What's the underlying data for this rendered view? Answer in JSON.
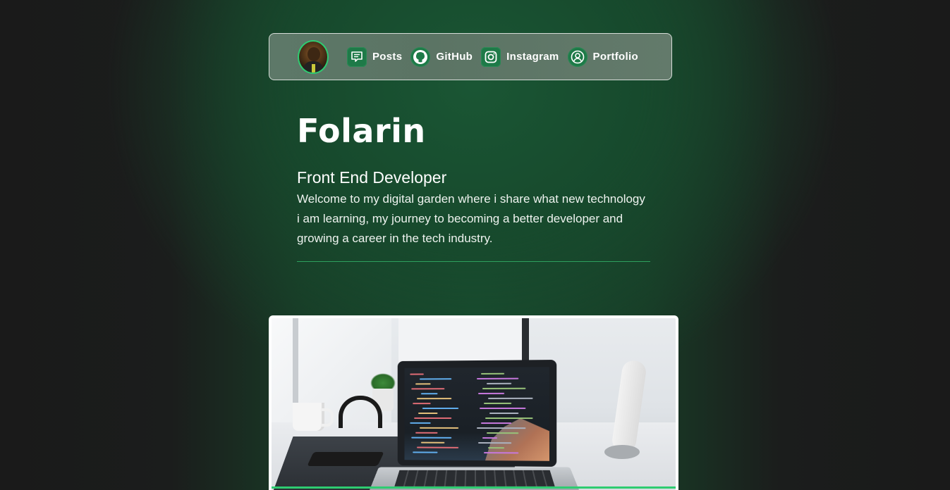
{
  "nav": {
    "items": [
      {
        "label": "Posts",
        "icon": "posts-icon"
      },
      {
        "label": "GitHub",
        "icon": "github-icon"
      },
      {
        "label": "Instagram",
        "icon": "instagram-icon"
      },
      {
        "label": "Portfolio",
        "icon": "portfolio-icon"
      }
    ]
  },
  "hero": {
    "name": "Folarin",
    "role": "Front End Developer",
    "bio": "Welcome to my digital garden where i share what new technology i am learning, my journey to becoming a better developer and growing a career in the tech industry."
  },
  "colors": {
    "accent": "#2ecc71",
    "background_dark": "#1a1a1a",
    "background_green": "#184a2e"
  }
}
